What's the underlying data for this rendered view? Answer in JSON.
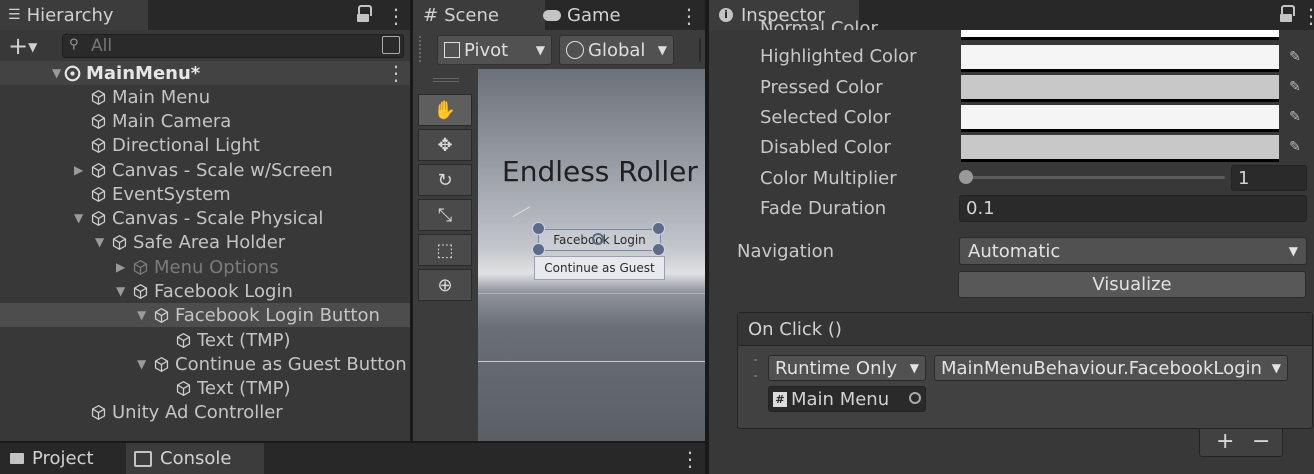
{
  "hierarchy": {
    "tab_label": "Hierarchy",
    "search_placeholder": "All",
    "scene_name": "MainMenu*",
    "items": [
      {
        "label": "Main Menu"
      },
      {
        "label": "Main Camera"
      },
      {
        "label": "Directional Light"
      },
      {
        "label": "Canvas - Scale w/Screen"
      },
      {
        "label": "EventSystem"
      },
      {
        "label": "Canvas - Scale Physical"
      },
      {
        "label": "Safe Area Holder"
      },
      {
        "label": "Menu Options"
      },
      {
        "label": "Facebook Login"
      },
      {
        "label": "Facebook Login Button"
      },
      {
        "label": "Text (TMP)"
      },
      {
        "label": "Continue as Guest Button"
      },
      {
        "label": "Text (TMP)"
      },
      {
        "label": "Unity Ad Controller"
      }
    ]
  },
  "bottom_tabs": {
    "project": "Project",
    "console": "Console"
  },
  "scene": {
    "tab_scene": "Scene",
    "tab_game": "Game",
    "pivot_label": "Pivot",
    "global_label": "Global",
    "title_text": "Endless Roller",
    "fb_button_text": "Facebook Login",
    "guest_button_text": "Continue as Guest"
  },
  "inspector": {
    "tab_label": "Inspector",
    "colors": [
      {
        "label": "Normal Color",
        "value": "#ffffff"
      },
      {
        "label": "Highlighted Color",
        "value": "#f5f5f5"
      },
      {
        "label": "Pressed Color",
        "value": "#c8c8c8"
      },
      {
        "label": "Selected Color",
        "value": "#f5f5f5"
      },
      {
        "label": "Disabled Color",
        "value": "#c8c8c8"
      }
    ],
    "color_multiplier_label": "Color Multiplier",
    "color_multiplier_value": "1",
    "color_multiplier_fraction": 0,
    "fade_duration_label": "Fade Duration",
    "fade_duration_value": "0.1",
    "navigation_label": "Navigation",
    "navigation_value": "Automatic",
    "visualize_label": "Visualize",
    "onclick_header": "On Click ()",
    "runtime_value": "Runtime Only",
    "function_value": "MainMenuBehaviour.FacebookLogin",
    "object_value": "Main Menu",
    "add_label": "+",
    "remove_label": "−"
  }
}
